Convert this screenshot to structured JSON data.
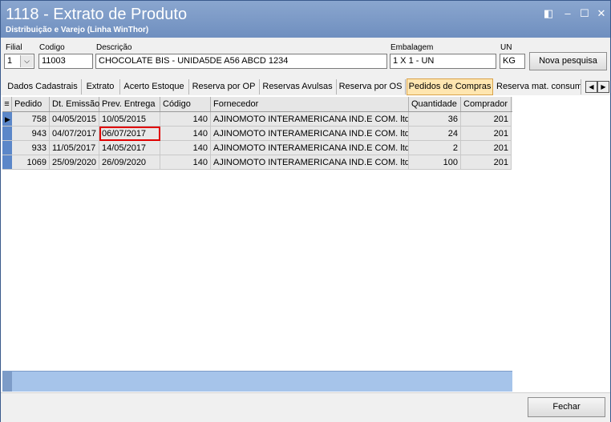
{
  "window": {
    "title": "1118 - Extrato de Produto",
    "subtitle": "Distribuição e Varejo (Linha WinThor)"
  },
  "form": {
    "filial_label": "Filial",
    "filial_value": "1",
    "codigo_label": "Codigo",
    "codigo_value": "11003",
    "descricao_label": "Descrição",
    "descricao_value": "CHOCOLATE BIS - UNIDA5DE A56 ABCD 1234",
    "embalagem_label": "Embalagem",
    "embalagem_value": "1 X 1 - UN",
    "un_label": "UN",
    "un_value": "KG",
    "nova_pesquisa": "Nova pesquisa"
  },
  "tabs": [
    "Dados Cadastrais",
    "Extrato",
    "Acerto Estoque",
    "Reserva por OP",
    "Reservas Avulsas",
    "Reserva por OS",
    "Pedidos de Compras",
    "Reserva mat. consumo"
  ],
  "grid": {
    "columns": [
      "Pedido",
      "Dt. Emissão",
      "Prev. Entrega",
      "Código",
      "Fornecedor",
      "Quantidade",
      "Comprador"
    ],
    "rows": [
      [
        "758",
        "04/05/2015",
        "10/05/2015",
        "140",
        "AJINOMOTO INTERAMERICANA IND.E COM. ltda",
        "36",
        "201"
      ],
      [
        "943",
        "04/07/2017",
        "06/07/2017",
        "140",
        "AJINOMOTO INTERAMERICANA IND.E COM. ltda",
        "24",
        "201"
      ],
      [
        "933",
        "11/05/2017",
        "14/05/2017",
        "140",
        "AJINOMOTO INTERAMERICANA IND.E COM. ltda",
        "2",
        "201"
      ],
      [
        "1069",
        "25/09/2020",
        "26/09/2020",
        "140",
        "AJINOMOTO INTERAMERICANA IND.E COM. ltda",
        "100",
        "201"
      ]
    ]
  },
  "fechar": "Fechar",
  "colors": {
    "titlebar": "#7b98c6",
    "highlight": "#e00000",
    "active_tab": "#ffe6b0",
    "footer": "#a6c4ea"
  }
}
